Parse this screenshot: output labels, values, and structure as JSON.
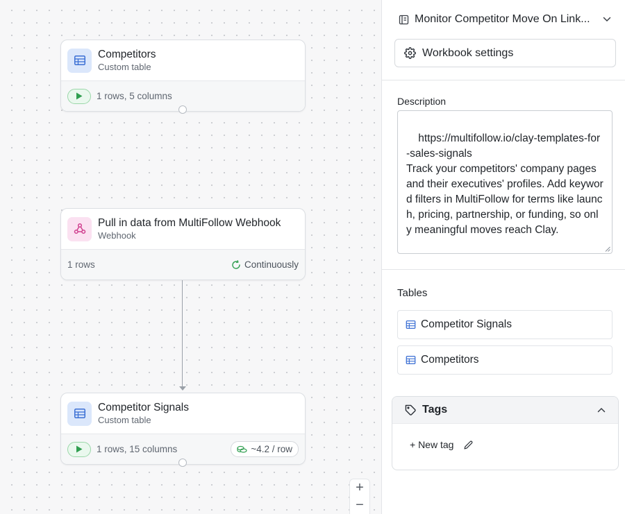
{
  "canvas": {
    "nodes": [
      {
        "title": "Competitors",
        "subtitle": "Custom table",
        "footer_text": "1 rows, 5 columns",
        "icon": "table-icon"
      },
      {
        "title": "Pull in data from MultiFollow Webhook",
        "subtitle": "Webhook",
        "footer_text": "1 rows",
        "status": "Continuously",
        "icon": "webhook-icon"
      },
      {
        "title": "Competitor Signals",
        "subtitle": "Custom table",
        "footer_text": "1 rows, 15 columns",
        "cost": "~4.2 / row",
        "icon": "table-icon"
      }
    ],
    "zoom": {
      "in": "+",
      "out": "−"
    }
  },
  "panel": {
    "workbook_title": "Monitor Competitor Move On Link...",
    "settings_label": "Workbook settings",
    "description_label": "Description",
    "description_text": "https://multifollow.io/clay-templates-for-sales-signals\nTrack your competitors' company pages and their executives' profiles. Add keyword filters in MultiFollow for terms like launch, pricing, partnership, or funding, so only meaningful moves reach Clay.",
    "tables_label": "Tables",
    "tables": [
      "Competitor Signals",
      "Competitors"
    ],
    "tags_label": "Tags",
    "new_tag_label": "+ New tag"
  },
  "colors": {
    "accent_blue": "#3b6fd4",
    "webhook_pink": "#d0408f",
    "run_green": "#2f9e4f"
  }
}
